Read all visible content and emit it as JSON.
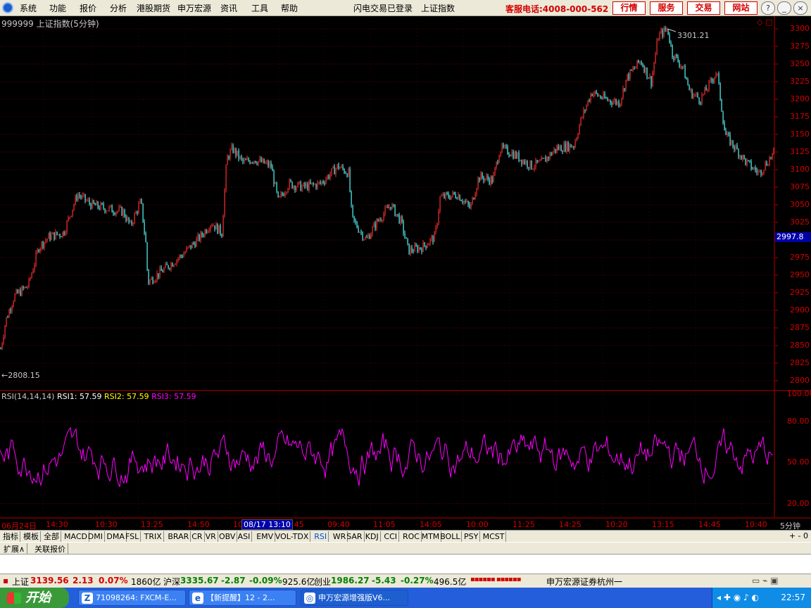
{
  "menu": {
    "items": [
      "系统",
      "功能",
      "报价",
      "分析",
      "港股期货",
      "申万宏源",
      "资讯",
      "工具",
      "帮助"
    ],
    "login_status": "闪电交易已登录",
    "index_name": "上证指数",
    "hotline": "客服电话:4008-000-562",
    "buttons": [
      "行情",
      "服务",
      "交易",
      "网站"
    ]
  },
  "main": {
    "title": "999999 上证指数(5分钟)",
    "corner_marks": "◇ □",
    "high_label": "3301.21",
    "low_label": "2808.15",
    "price_tag": "2997.8",
    "y_ticks": [
      "3300",
      "3275",
      "3250",
      "3225",
      "3200",
      "3175",
      "3150",
      "3125",
      "3100",
      "3075",
      "3050",
      "3025",
      "3000",
      "2975",
      "2950",
      "2925",
      "2900",
      "2875",
      "2850",
      "2825",
      "2800"
    ]
  },
  "rsi": {
    "title": "RSI(14,14,14)",
    "rsi1": "RSI1: 57.59",
    "rsi2": "RSI2: 57.59",
    "rsi3": "RSI3: 57.59",
    "y_ticks": [
      "100.00",
      "80.00",
      "50.00",
      "20.00"
    ],
    "colors": {
      "rsi1": "#ffffff",
      "rsi2": "#ffff00",
      "rsi3": "#ff00ff"
    }
  },
  "xaxis": {
    "labels": [
      "06月24日",
      "14:30",
      "10:30",
      "13:25",
      "14:50",
      "10",
      "13:45",
      "09:40",
      "11:05",
      "14:05",
      "10:00",
      "11:25",
      "14:25",
      "10:20",
      "13:15",
      "14:45",
      "10:40"
    ],
    "cursor": "08/17 13:10",
    "period": "5分钟"
  },
  "indicators": {
    "items": [
      "指标",
      "模板",
      "全部",
      "MACD",
      "DMI",
      "DMA",
      "FSL",
      "TRIX",
      "BRAR",
      "CR",
      "VR",
      "OBV",
      "ASI",
      "EMV",
      "VOL-TDX",
      "RSI",
      "WR",
      "SAR",
      "KDJ",
      "CCI",
      "ROC",
      "MTM",
      "BOLL",
      "PSY",
      "MCST"
    ],
    "active": "RSI",
    "controls": "+ - 0"
  },
  "ext": {
    "items": [
      "扩展∧",
      "关联报价"
    ]
  },
  "status": {
    "sh_name": "上证",
    "sh_value": "3139.56",
    "sh_change": "2.13",
    "sh_pct": "0.07%",
    "sh_amount": "1860亿",
    "hs_name": "沪深",
    "hs_value": "3335.67",
    "hs_change": "-2.87",
    "hs_pct": "-0.09%",
    "hs_amount": "925.6亿",
    "cy_name": "创业",
    "cy_value": "1986.27",
    "cy_change": "-5.43",
    "cy_pct": "-0.27%",
    "cy_amount": "496.5亿",
    "broker": "申万宏源证券杭州一"
  },
  "taskbar": {
    "start": "开始",
    "tasks": [
      "71098264: FXCM-E...",
      "【新提醒】12 - 2...",
      "申万宏源增强版V6..."
    ],
    "clock": "22:57"
  },
  "chart_data": {
    "type": "line",
    "title": "999999 上证指数(5分钟)",
    "ylim": [
      2800,
      3300
    ],
    "anchors": [
      [
        0,
        2840
      ],
      [
        8,
        2885
      ],
      [
        20,
        2920
      ],
      [
        40,
        2935
      ],
      [
        55,
        2990
      ],
      [
        70,
        3005
      ],
      [
        90,
        3010
      ],
      [
        110,
        3065
      ],
      [
        130,
        3050
      ],
      [
        150,
        3045
      ],
      [
        175,
        3040
      ],
      [
        185,
        3020
      ],
      [
        200,
        3055
      ],
      [
        207,
        2995
      ],
      [
        210,
        2940
      ],
      [
        235,
        2960
      ],
      [
        260,
        2980
      ],
      [
        285,
        3005
      ],
      [
        300,
        3025
      ],
      [
        315,
        3010
      ],
      [
        322,
        3115
      ],
      [
        330,
        3130
      ],
      [
        345,
        3110
      ],
      [
        360,
        3115
      ],
      [
        385,
        3105
      ],
      [
        395,
        3055
      ],
      [
        410,
        3080
      ],
      [
        430,
        3075
      ],
      [
        455,
        3080
      ],
      [
        470,
        3095
      ],
      [
        480,
        3105
      ],
      [
        495,
        3095
      ],
      [
        500,
        3030
      ],
      [
        520,
        3000
      ],
      [
        535,
        3025
      ],
      [
        555,
        3050
      ],
      [
        570,
        3025
      ],
      [
        580,
        2985
      ],
      [
        600,
        2990
      ],
      [
        618,
        3005
      ],
      [
        625,
        3060
      ],
      [
        650,
        3065
      ],
      [
        668,
        3045
      ],
      [
        680,
        3090
      ],
      [
        700,
        3085
      ],
      [
        710,
        3130
      ],
      [
        725,
        3125
      ],
      [
        740,
        3115
      ],
      [
        755,
        3105
      ],
      [
        770,
        3110
      ],
      [
        790,
        3130
      ],
      [
        815,
        3135
      ],
      [
        825,
        3170
      ],
      [
        840,
        3210
      ],
      [
        860,
        3200
      ],
      [
        880,
        3195
      ],
      [
        890,
        3230
      ],
      [
        910,
        3255
      ],
      [
        925,
        3225
      ],
      [
        935,
        3290
      ],
      [
        948,
        3300
      ],
      [
        955,
        3265
      ],
      [
        970,
        3245
      ],
      [
        980,
        3210
      ],
      [
        995,
        3200
      ],
      [
        1010,
        3225
      ],
      [
        1018,
        3240
      ],
      [
        1030,
        3150
      ],
      [
        1045,
        3130
      ],
      [
        1060,
        3110
      ],
      [
        1078,
        3095
      ],
      [
        1100,
        3125
      ]
    ]
  }
}
